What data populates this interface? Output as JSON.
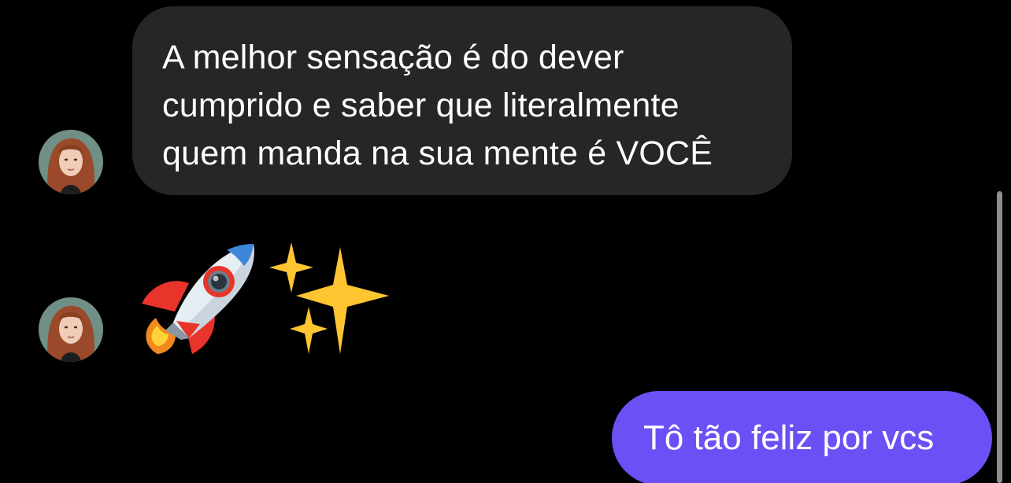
{
  "thread": {
    "incoming_message": {
      "lines": [
        "A melhor sensação é do dever",
        "cumprido e saber que literalmente",
        "quem manda na sua mente é VOCÊ"
      ]
    },
    "incoming_emoji": {
      "emojis": [
        "🚀",
        "✨"
      ]
    },
    "outgoing_message": {
      "text": "Tô tão feliz por vcs"
    }
  },
  "colors": {
    "background": "#000000",
    "incoming_bubble": "#262626",
    "outgoing_bubble": "#6d4ff6",
    "text": "#ffffff"
  },
  "icons": {
    "avatar": "profile-photo",
    "emoji_rocket": "rocket-emoji",
    "emoji_sparkles": "sparkles-emoji"
  }
}
